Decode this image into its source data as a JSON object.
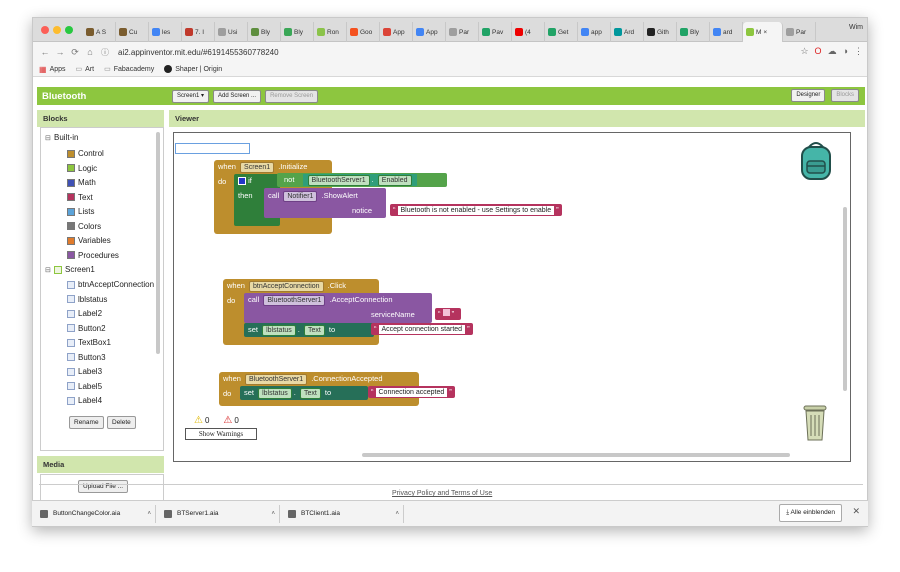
{
  "browser": {
    "tabs": [
      {
        "label": "A S",
        "color": "#7a5c2e"
      },
      {
        "label": "Cu",
        "color": "#7a5c2e"
      },
      {
        "label": "les",
        "color": "#4285f4"
      },
      {
        "label": "7. I",
        "color": "#c0392b"
      },
      {
        "label": "Usi",
        "color": "#9e9e9e"
      },
      {
        "label": "Bly",
        "color": "#5e8e3e"
      },
      {
        "label": "Bly",
        "color": "#3aa757"
      },
      {
        "label": "Ron",
        "color": "#8bc34a"
      },
      {
        "label": "Goo",
        "color": "#f4511e"
      },
      {
        "label": "App",
        "color": "#db4437"
      },
      {
        "label": "App",
        "color": "#4285f4"
      },
      {
        "label": "Par",
        "color": "#9e9e9e"
      },
      {
        "label": "Pav",
        "color": "#21a366"
      },
      {
        "label": "(4",
        "color": "#e00"
      },
      {
        "label": "Get",
        "color": "#21a366"
      },
      {
        "label": "app",
        "color": "#4285f4"
      },
      {
        "label": "Ard",
        "color": "#00979c"
      },
      {
        "label": "Gith",
        "color": "#222"
      },
      {
        "label": "Bly",
        "color": "#21a366"
      },
      {
        "label": "ard",
        "color": "#4285f4"
      },
      {
        "label": "M",
        "color": "#8dc63f",
        "active": true
      },
      {
        "label": "Par",
        "color": "#9e9e9e"
      }
    ],
    "profile": "Wim",
    "url": "ai2.appinventor.mit.edu/#6191455360778240",
    "bookmarks": [
      "Apps",
      "Art",
      "Fabacademy",
      "Shaper | Origin"
    ]
  },
  "app": {
    "title": "Bluetooth",
    "screen_select": "Screen1 ▾",
    "add_screen": "Add Screen ...",
    "remove_screen": "Remove Screen",
    "designer": "Designer",
    "blocks": "Blocks"
  },
  "blocks_panel": {
    "header": "Blocks",
    "builtin": "Built-in",
    "builtin_items": [
      {
        "label": "Control",
        "color": "#bd8e2d"
      },
      {
        "label": "Logic",
        "color": "#8dc63f"
      },
      {
        "label": "Math",
        "color": "#3f51b5"
      },
      {
        "label": "Text",
        "color": "#b5335e"
      },
      {
        "label": "Lists",
        "color": "#5ba3d9"
      },
      {
        "label": "Colors",
        "color": "#777"
      },
      {
        "label": "Variables",
        "color": "#e07b2c"
      },
      {
        "label": "Procedures",
        "color": "#8a57a2"
      }
    ],
    "screen": "Screen1",
    "components": [
      "btnAcceptConnection",
      "lblstatus",
      "Label2",
      "Button2",
      "TextBox1",
      "Button3",
      "Label3",
      "Label5",
      "Label4"
    ],
    "rename": "Rename",
    "delete": "Delete"
  },
  "media_panel": {
    "header": "Media",
    "upload": "Upload File ..."
  },
  "viewer": {
    "header": "Viewer",
    "warnings_count": "0",
    "errors_count": "0",
    "show_warnings": "Show Warnings",
    "block1": {
      "when": "when",
      "component": "Screen1",
      "event": ".Initialize",
      "do": "do",
      "if": "if",
      "not": "not",
      "bt_component": "BluetoothServer1",
      "property": "Enabled",
      "then": "then",
      "call": "call",
      "notifier": "Notifier1",
      "method": ".ShowAlert",
      "notice": "notice",
      "message": "Bluetooth is not enabled - use Settings to enable"
    },
    "block2": {
      "when": "when",
      "component": "btnAcceptConnection",
      "event": ".Click",
      "do": "do",
      "call": "call",
      "bt_component": "BluetoothServer1",
      "method": ".AcceptConnection",
      "param": "serviceName",
      "set": "set",
      "target": "lblstatus",
      "property": "Text",
      "to": "to",
      "message": "Accept connection started"
    },
    "block3": {
      "when": "when",
      "component": "BluetoothServer1",
      "event": ".ConnectionAccepted",
      "do": "do",
      "set": "set",
      "target": "lblstatus",
      "property": "Text",
      "to": "to",
      "message": "Connection accepted"
    }
  },
  "footer": {
    "privacy": "Privacy Policy and Terms of Use"
  },
  "downloads": {
    "files": [
      "ButtonChangeColor.aia",
      "BTServer1.aia",
      "BTClient1.aia"
    ],
    "show_all": "Alle einblenden"
  }
}
